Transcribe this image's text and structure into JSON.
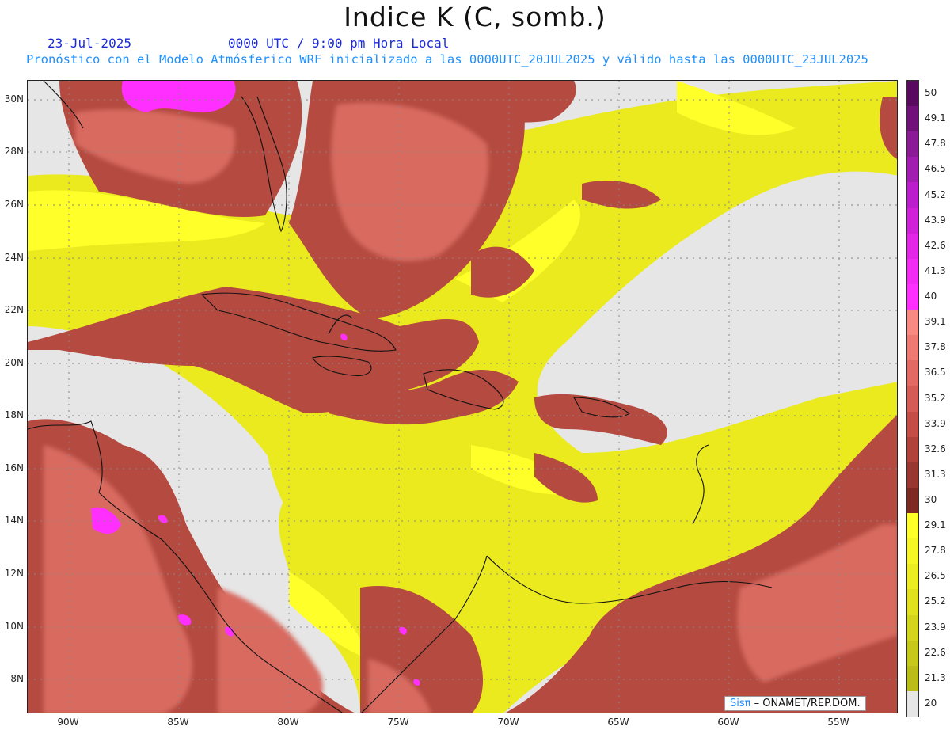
{
  "header": {
    "title": "Indice K (C, somb.)",
    "date": "23-Jul-2025",
    "utc_time": "0000 UTC / 9:00 pm Hora Local",
    "forecast_text": "Pronóstico con el Modelo Atmósferico WRF inicializado a las 0000UTC_20JUL2025 y válido hasta las  0000UTC_23JUL2025"
  },
  "axes": {
    "lat_labels": [
      "30N",
      "28N",
      "26N",
      "24N",
      "22N",
      "20N",
      "18N",
      "16N",
      "14N",
      "12N",
      "10N",
      "8N"
    ],
    "lon_labels": [
      "90W",
      "85W",
      "80W",
      "75W",
      "70W",
      "65W",
      "60W",
      "55W"
    ]
  },
  "colorbar": {
    "labels": [
      "50",
      "49.1",
      "47.8",
      "46.5",
      "45.2",
      "43.9",
      "42.6",
      "41.3",
      "40",
      "39.1",
      "37.8",
      "36.5",
      "35.2",
      "33.9",
      "32.6",
      "31.3",
      "30",
      "29.1",
      "27.8",
      "26.5",
      "25.2",
      "23.9",
      "22.6",
      "21.3",
      "20"
    ],
    "colors": [
      "#5a0a5e",
      "#72107a",
      "#8a1a96",
      "#a21cb2",
      "#bb1ccc",
      "#d020d8",
      "#e225e6",
      "#f22af2",
      "#ff30ff",
      "#f88a82",
      "#ee7a72",
      "#e26a62",
      "#d45c54",
      "#c44e46",
      "#b0423a",
      "#9a3630",
      "#7e2a22",
      "#ffff2a",
      "#f6f626",
      "#ecec22",
      "#e0e01e",
      "#d4d41c",
      "#c8c81a",
      "#bcbc18",
      "#e6e6e6"
    ]
  },
  "credit": {
    "brand": "Sisπ",
    "text": "– ONAMET/REP.DOM."
  }
}
